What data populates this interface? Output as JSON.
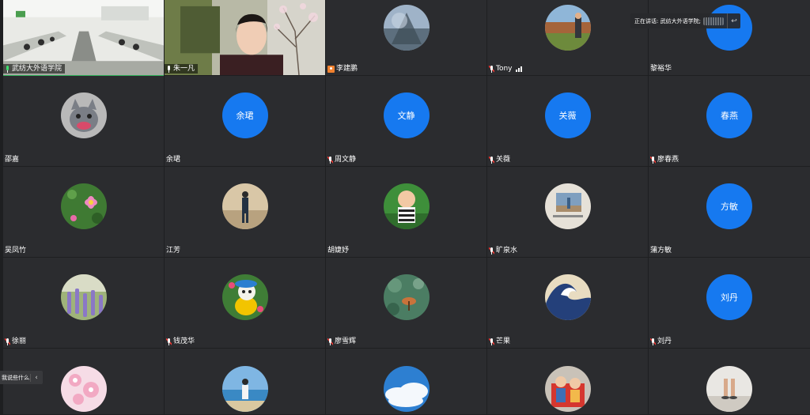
{
  "banner": {
    "text": "正在讲话: 武纺大外语学院;",
    "collapse_icon": "collapse-arrow-icon"
  },
  "chat_hint": {
    "text": "我说些什么...",
    "chevron": "‹"
  },
  "colors": {
    "avatar_blue": "#1679f0",
    "active_border": "#2fb15a",
    "tile_bg": "#2b2c2f"
  },
  "participants": [
    {
      "name": "武纺大外语学院",
      "type": "video",
      "scene": "classroom",
      "mic": "on",
      "active": true
    },
    {
      "name": "朱一凡",
      "type": "video",
      "scene": "person",
      "mic": "normal"
    },
    {
      "name": "李建鹏",
      "type": "photo",
      "art": "sky-tree",
      "mic": "camera"
    },
    {
      "name": "Tony",
      "type": "photo",
      "art": "hiker",
      "mic": "muted",
      "signal": true
    },
    {
      "name": "黎裕华",
      "type": "text",
      "initials": "",
      "mic": "none"
    },
    {
      "name": "邵嘉",
      "type": "photo",
      "art": "kitten",
      "mic": "none"
    },
    {
      "name": "余珺",
      "type": "text",
      "initials": "余珺",
      "mic": "none"
    },
    {
      "name": "周文静",
      "type": "text",
      "initials": "文静",
      "mic": "muted"
    },
    {
      "name": "关薇",
      "type": "text",
      "initials": "关薇",
      "mic": "muted"
    },
    {
      "name": "廖春燕",
      "type": "text",
      "initials": "春燕",
      "mic": "muted"
    },
    {
      "name": "吴凤竹",
      "type": "photo",
      "art": "flower",
      "mic": "none"
    },
    {
      "name": "江芳",
      "type": "photo",
      "art": "walker",
      "mic": "none"
    },
    {
      "name": "胡婕妤",
      "type": "photo",
      "art": "baby",
      "mic": "none"
    },
    {
      "name": "旷泉水",
      "type": "photo",
      "art": "painting",
      "mic": "muted"
    },
    {
      "name": "蒲方敏",
      "type": "text",
      "initials": "方敏",
      "mic": "none"
    },
    {
      "name": "徐丽",
      "type": "photo",
      "art": "lavender",
      "mic": "muted"
    },
    {
      "name": "钱茂华",
      "type": "photo",
      "art": "duck",
      "mic": "muted"
    },
    {
      "name": "廖雪辉",
      "type": "photo",
      "art": "bokeh",
      "mic": "muted"
    },
    {
      "name": "芒果",
      "type": "photo",
      "art": "wave",
      "mic": "muted"
    },
    {
      "name": "刘丹",
      "type": "text",
      "initials": "刘丹",
      "mic": "muted"
    },
    {
      "name": "",
      "type": "photo",
      "art": "blossom",
      "mic": "none"
    },
    {
      "name": "",
      "type": "photo",
      "art": "beach",
      "mic": "none"
    },
    {
      "name": "",
      "type": "photo",
      "art": "clouds",
      "mic": "none"
    },
    {
      "name": "",
      "type": "photo",
      "art": "kids",
      "mic": "none"
    },
    {
      "name": "",
      "type": "photo",
      "art": "feet",
      "mic": "none"
    }
  ]
}
